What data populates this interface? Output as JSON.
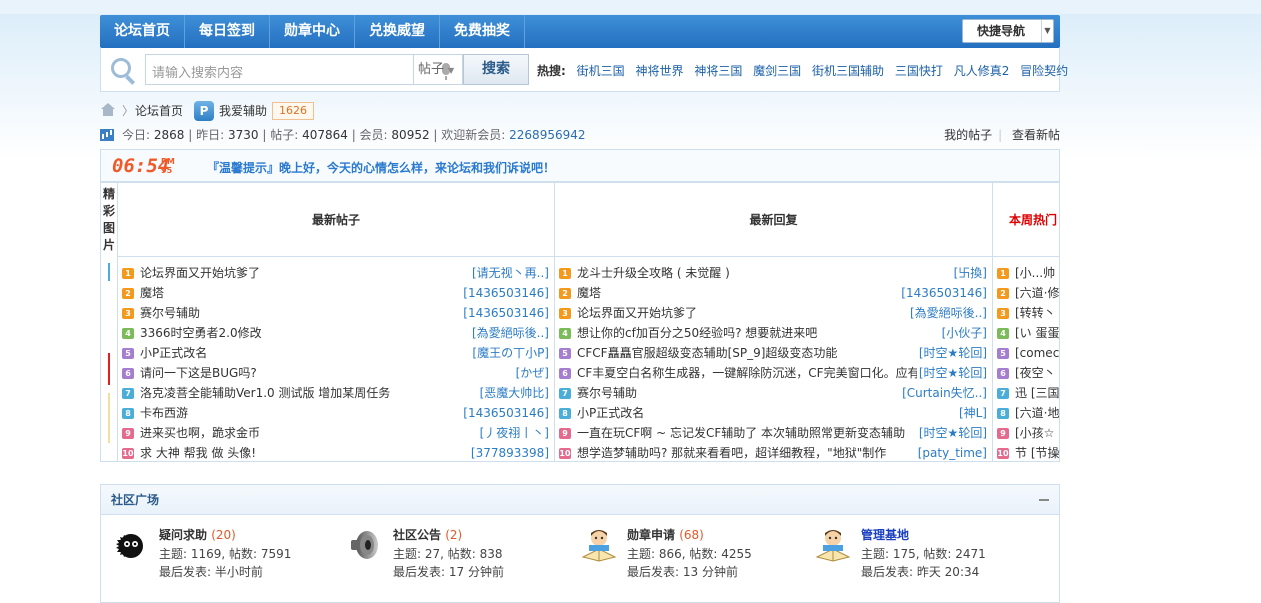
{
  "nav": {
    "items": [
      "论坛首页",
      "每日签到",
      "勋章中心",
      "兑换威望",
      "免费抽奖"
    ],
    "quick_nav": "快捷导航"
  },
  "search": {
    "placeholder": "请输入搜索内容",
    "type": "帖子",
    "button": "搜索",
    "hot_label": "热搜:",
    "hot": [
      "街机三国",
      "神将世界",
      "神将三国",
      "魔剑三国",
      "街机三国辅助",
      "三国快打",
      "凡人修真2",
      "冒险契约"
    ]
  },
  "breadcrumb": {
    "home": "论坛首页",
    "forum": "我爱辅助",
    "forum_icon": "P",
    "count": "1626"
  },
  "stats": {
    "today_label": "今日:",
    "today": "2868",
    "yesterday_label": "昨日:",
    "yesterday": "3730",
    "posts_label": "帖子:",
    "posts": "407864",
    "members_label": "会员:",
    "members": "80952",
    "welcome_label": "欢迎新会员:",
    "welcome": "2268956942",
    "my_posts": "我的帖子",
    "new_posts": "查看新帖"
  },
  "tip": {
    "time": "06:54",
    "ampm_top": "PM",
    "ampm_bottom": "95",
    "message": "『温馨提示』晚上好，今天的心情怎么样，来论坛和我们诉说吧！"
  },
  "board": {
    "side_label": [
      "精",
      "彩",
      "图",
      "片"
    ],
    "columns": [
      {
        "title": "最新帖子",
        "rows": [
          {
            "title": "论坛界面又开始坑爹了",
            "user": "[请无视丶再..]"
          },
          {
            "title": "魔塔",
            "user": "[1436503146]"
          },
          {
            "title": "赛尔号辅助",
            "user": "[1436503146]"
          },
          {
            "title": "3366时空勇者2.0修改",
            "user": "[為愛絕呩後..]"
          },
          {
            "title": "小P正式改名",
            "user": "[魔王の丅小P]"
          },
          {
            "title": "请问一下这是BUG吗?",
            "user": "[かぜ]"
          },
          {
            "title": "洛克凌菩全能辅助Ver1.0 测试版 增加某周任务",
            "user": "[恶魔大帅比]"
          },
          {
            "title": "卡布西游",
            "user": "[1436503146]"
          },
          {
            "title": "进来买也啊，跪求金币",
            "user": "[丿夜祤丨丶]"
          },
          {
            "title": "求 大神 帮我 做 头像!",
            "user": "[377893398]"
          }
        ]
      },
      {
        "title": "最新回复",
        "rows": [
          {
            "title": "龙斗士升级全攻略 ( 未觉醒 )",
            "user": "[卐換]"
          },
          {
            "title": "魔塔",
            "user": "[1436503146]"
          },
          {
            "title": "论坛界面又开始坑爹了",
            "user": "[為愛絕呩後..]"
          },
          {
            "title": "想让你的cf加百分之50经验吗? 想要就进来吧",
            "user": "[小伙子]"
          },
          {
            "title": "CFCF矗矗官服超级变态辅助[SP_9]超级变态功能",
            "user": "[时空★轮回]"
          },
          {
            "title": "CF丰夏空白名称生成器，一键解除防沉迷，CF完美窗口化。应有",
            "user": "[时空★轮回]"
          },
          {
            "title": "赛尔号辅助",
            "user": "[Curtain失忆..]"
          },
          {
            "title": "小P正式改名",
            "user": "[神L]"
          },
          {
            "title": "一直在玩CF啊 ~ 忘记发CF辅助了 本次辅助照常更新变态辅助",
            "user": "[时空★轮回]"
          },
          {
            "title": "想学造梦辅助吗? 那就来看看吧，超详细教程，\"地狱\"制作",
            "user": "[paty_time]"
          }
        ]
      },
      {
        "title": "本周热门",
        "rows": [
          {
            "title": "[小...帅",
            "user": ""
          },
          {
            "title": "[六道·修",
            "user": ""
          },
          {
            "title": "[转转丶",
            "user": ""
          },
          {
            "title": "[い 蛋蛋",
            "user": ""
          },
          {
            "title": "[comec",
            "user": ""
          },
          {
            "title": "[夜空丶",
            "user": ""
          },
          {
            "title": "迅 [三国",
            "user": ""
          },
          {
            "title": "[六道·地",
            "user": ""
          },
          {
            "title": "[小孩☆",
            "user": ""
          },
          {
            "title": "节 [节操",
            "user": ""
          }
        ]
      }
    ],
    "number_colors": [
      "#f39a1e",
      "#f39a1e",
      "#f39a1e",
      "#7cbb5a",
      "#a57ed0",
      "#a57ed0",
      "#4aaed8",
      "#4aaed8",
      "#e46a8e",
      "#e46a8e"
    ]
  },
  "community": {
    "title": "社区广场",
    "forums": [
      {
        "name": "疑问求助",
        "count": "(20)",
        "stats": "主题: 1169, 帖数: 7591",
        "last": "最后发表: 半小时前",
        "icon": "soot-sprite-icon"
      },
      {
        "name": "社区公告",
        "count": "(2)",
        "stats": "主题: 27, 帖数: 838",
        "last": "最后发表: 17 分钟前",
        "icon": "speaker-icon"
      },
      {
        "name": "勋章申请",
        "count": "(68)",
        "stats": "主题: 866, 帖数: 4255",
        "last": "最后发表: 13 分钟前",
        "icon": "reader-icon"
      },
      {
        "name": "管理基地",
        "count": "",
        "stats": "主题: 175, 帖数: 2471",
        "last": "最后发表: 昨天 20:34",
        "icon": "reader-icon"
      }
    ]
  }
}
